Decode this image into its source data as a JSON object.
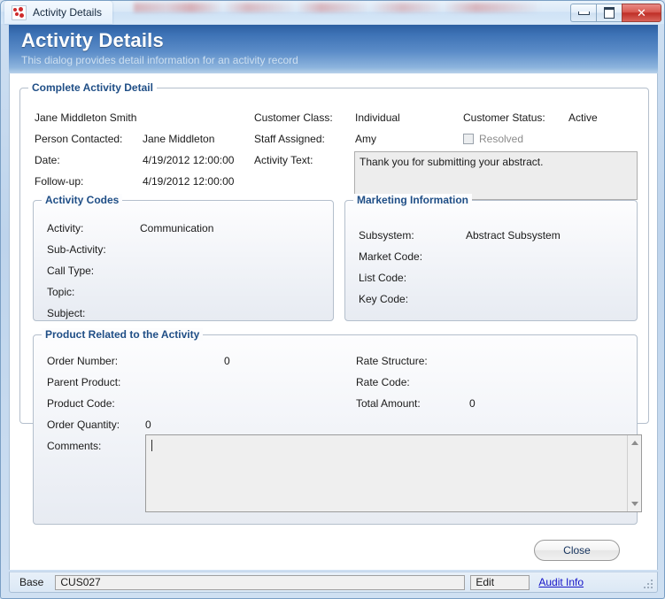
{
  "window": {
    "title": "Activity Details",
    "icon": "activity-dots-icon",
    "controls": {
      "minimize": "minimize-icon",
      "maximize": "maximize-icon",
      "close": "✕"
    }
  },
  "banner": {
    "heading": "Activity Details",
    "subheading": "This dialog provides detail information for an activity record"
  },
  "complete_activity_detail": {
    "legend": "Complete Activity Detail",
    "customer_name": "Jane Middleton Smith",
    "fields": {
      "person_contacted_label": "Person Contacted:",
      "person_contacted_value": "Jane Middleton",
      "date_label": "Date:",
      "date_value": "4/19/2012 12:00:00",
      "followup_label": "Follow-up:",
      "followup_value": "4/19/2012 12:00:00",
      "customer_class_label": "Customer Class:",
      "customer_class_value": "Individual",
      "staff_assigned_label": "Staff Assigned:",
      "staff_assigned_value": "Amy",
      "activity_text_label": "Activity Text:",
      "activity_text_value": "Thank you for submitting your abstract.",
      "customer_status_label": "Customer Status:",
      "customer_status_value": "Active",
      "resolved_label": "Resolved",
      "resolved_checked": false
    }
  },
  "activity_codes": {
    "legend": "Activity Codes",
    "rows": [
      {
        "label": "Activity:",
        "value": "Communication"
      },
      {
        "label": "Sub-Activity:",
        "value": ""
      },
      {
        "label": "Call Type:",
        "value": ""
      },
      {
        "label": "Topic:",
        "value": ""
      },
      {
        "label": "Subject:",
        "value": ""
      }
    ]
  },
  "marketing_information": {
    "legend": "Marketing Information",
    "rows": [
      {
        "label": "Subsystem:",
        "value": "Abstract Subsystem"
      },
      {
        "label": "Market Code:",
        "value": ""
      },
      {
        "label": "List Code:",
        "value": ""
      },
      {
        "label": "Key Code:",
        "value": ""
      }
    ]
  },
  "product_related": {
    "legend": "Product Related to the Activity",
    "left_rows": [
      {
        "label": "Order Number:",
        "value": "0"
      },
      {
        "label": "Parent Product:",
        "value": ""
      },
      {
        "label": "Product Code:",
        "value": ""
      },
      {
        "label": "Order Quantity:",
        "value": "0"
      }
    ],
    "right_rows": [
      {
        "label": "Rate Structure:",
        "value": ""
      },
      {
        "label": "Rate Code:",
        "value": ""
      },
      {
        "label": "Total Amount:",
        "value": "0"
      }
    ],
    "comments_label": "Comments:",
    "comments_value": "",
    "comments_scrollbar": {
      "up": "scroll-up-icon",
      "down": "scroll-down-icon"
    }
  },
  "footer": {
    "close_label": "Close"
  },
  "statusbar": {
    "base_label": "Base",
    "base_value": "CUS027",
    "edit_label": "Edit",
    "audit_link": "Audit Info"
  },
  "colors": {
    "banner_dark": "#2c5ea0",
    "banner_light": "#b9d2ea",
    "legend_blue": "#1f4e86",
    "link_blue": "#1414c8",
    "close_red": "#bf2f27"
  }
}
